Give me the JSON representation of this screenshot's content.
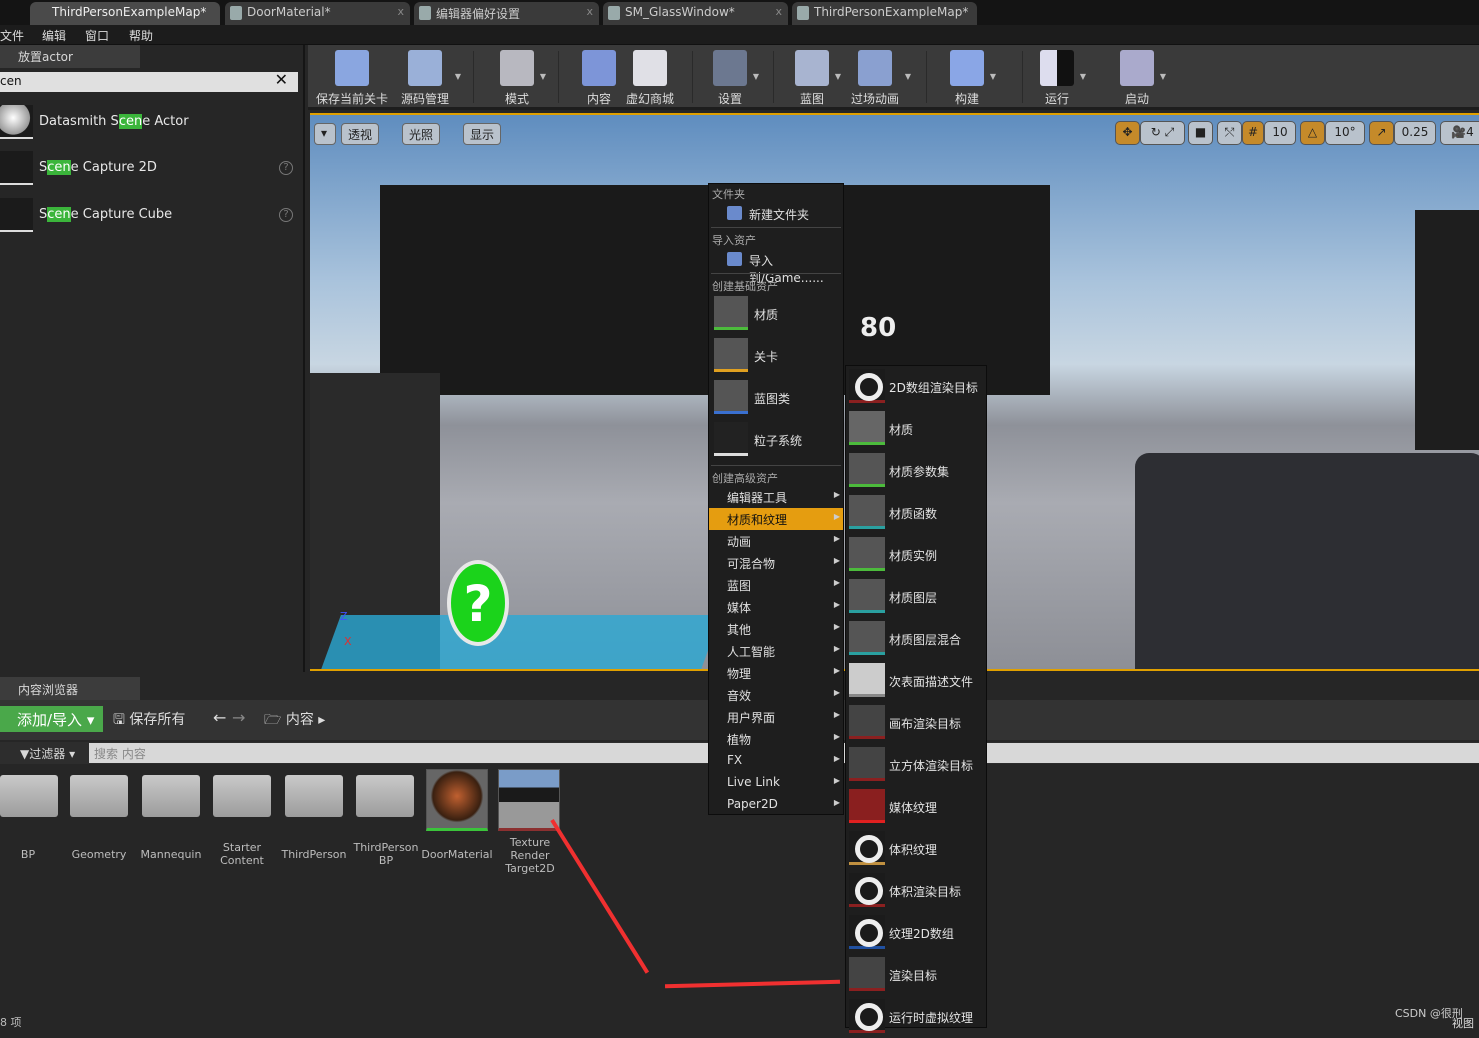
{
  "tabs": [
    {
      "label": "ThirdPersonExampleMap*",
      "active": true
    },
    {
      "label": "DoorMaterial*"
    },
    {
      "label": "编辑器偏好设置"
    },
    {
      "label": "SM_GlassWindow*"
    },
    {
      "label": "ThirdPersonExampleMap*"
    }
  ],
  "menu": [
    "文件",
    "编辑",
    "窗口",
    "帮助"
  ],
  "place_panel": {
    "tab": "放置actor",
    "search": "cen",
    "items": [
      "Datasmith Scene Actor",
      "Scene Capture 2D",
      "Scene Capture Cube"
    ],
    "highlight": "cen"
  },
  "toolbar": [
    "保存当前关卡",
    "源码管理",
    "模式",
    "内容",
    "虚幻商城",
    "设置",
    "蓝图",
    "过场动画",
    "构建",
    "运行",
    "启动"
  ],
  "viewport": {
    "buttons": [
      "透视",
      "光照",
      "显示"
    ],
    "grid_snap": "10",
    "rotation_snap": "10°",
    "scale_snap": "0.25",
    "camera_speed": "4",
    "label_80": "80",
    "axis_z": "Z",
    "axis_x": "X"
  },
  "context_menu": {
    "sections": [
      "文件夹",
      "导入资产",
      "创建基础资产",
      "创建高级资产"
    ],
    "new_folder": "新建文件夹",
    "import": "导入到/Game......",
    "basic": [
      "材质",
      "关卡",
      "蓝图类",
      "粒子系统"
    ],
    "advanced": [
      "编辑器工具",
      "材质和纹理",
      "动画",
      "可混合物",
      "蓝图",
      "媒体",
      "其他",
      "人工智能",
      "物理",
      "音效",
      "用户界面",
      "植物",
      "FX",
      "Live Link",
      "Paper2D"
    ],
    "selected": "材质和纹理"
  },
  "submenu": [
    "2D数组渲染目标",
    "材质",
    "材质参数集",
    "材质函数",
    "材质实例",
    "材质图层",
    "材质图层混合",
    "次表面描述文件",
    "画布渲染目标",
    "立方体渲染目标",
    "媒体纹理",
    "体积纹理",
    "体积渲染目标",
    "纹理2D数组",
    "渲染目标",
    "运行时虚拟纹理"
  ],
  "content_browser": {
    "tab": "内容浏览器",
    "add": "添加/导入",
    "save_all": "保存所有",
    "path": "内容",
    "filter": "过滤器",
    "search_placeholder": "搜索 内容",
    "folders": [
      "BP",
      "Geometry",
      "Mannequin",
      "Starter Content",
      "ThirdPerson",
      "ThirdPerson BP"
    ],
    "assets": [
      "DoorMaterial",
      "Texture Render Target2D"
    ],
    "count": "8 项",
    "view": "视图"
  },
  "watermark": "CSDN @很刑",
  "colors": {
    "accent": "#e59d10",
    "add_green": "#4aa84a",
    "highlight": "#3bb53b",
    "arrow": "#f03030"
  }
}
